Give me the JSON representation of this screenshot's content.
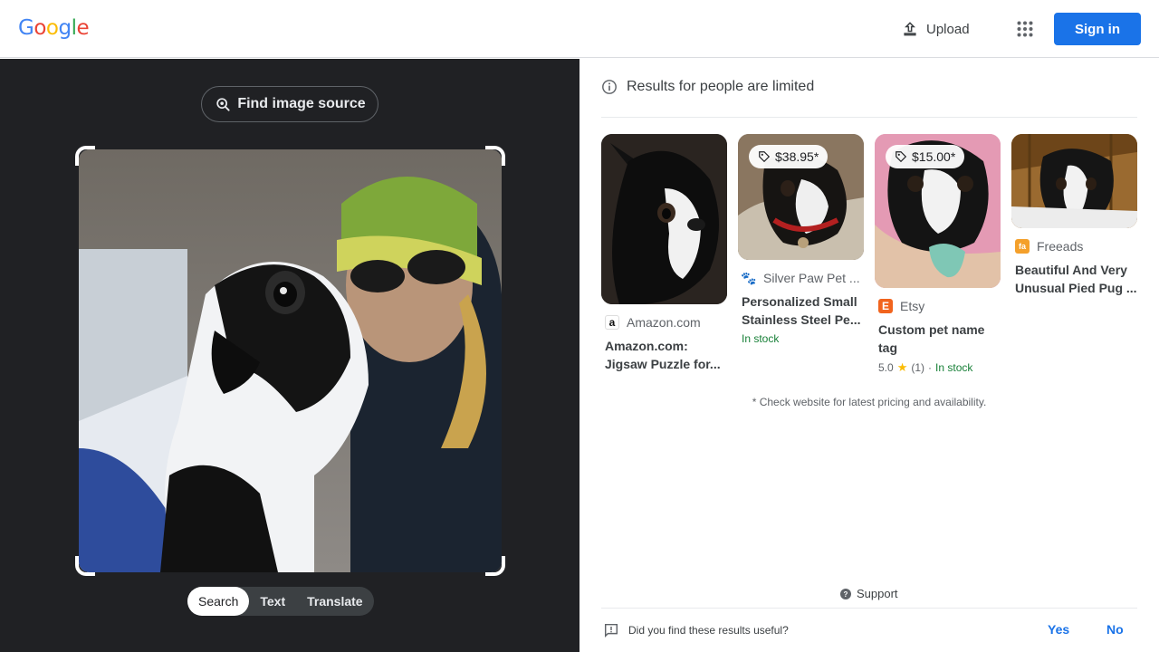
{
  "header": {
    "logo_letters": [
      {
        "char": "G",
        "color": "#4285f4"
      },
      {
        "char": "o",
        "color": "#ea4335"
      },
      {
        "char": "o",
        "color": "#fbbc05"
      },
      {
        "char": "g",
        "color": "#4285f4"
      },
      {
        "char": "l",
        "color": "#34a853"
      },
      {
        "char": "e",
        "color": "#ea4335"
      }
    ],
    "upload_label": "Upload",
    "upload_icon": "upload-icon",
    "apps_icon": "apps-grid-icon",
    "signin_label": "Sign in"
  },
  "lens": {
    "find_source_label": "Find image source",
    "find_source_icon": "image-search-icon",
    "tabs": [
      {
        "label": "Search",
        "active": true
      },
      {
        "label": "Text",
        "active": false
      },
      {
        "label": "Translate",
        "active": false
      }
    ]
  },
  "results": {
    "notice": "Results for people are limited",
    "notice_icon": "info-icon",
    "cards": [
      {
        "source": "Amazon.com",
        "source_icon": "amazon-icon",
        "title": "Amazon.com: Jigsaw Puzzle for...",
        "price": "",
        "stock": "",
        "rating": ""
      },
      {
        "source": "Silver Paw Pet ...",
        "source_icon": "paw-icon",
        "title": "Personalized Small Stainless Steel Pe...",
        "price": "$38.95*",
        "stock": "In stock",
        "rating": ""
      },
      {
        "source": "Etsy",
        "source_icon": "etsy-icon",
        "title": "Custom pet name tag",
        "price": "$15.00*",
        "stock": "",
        "rating": "5.0",
        "rating_count": "(1)",
        "rating_stock": "In stock"
      },
      {
        "source": "Freeads",
        "source_icon": "freeads-icon",
        "title": "Beautiful And Very Unusual Pied Pug ...",
        "price": "",
        "stock": "",
        "rating": ""
      }
    ],
    "pricing_note": "* Check website for latest pricing and availability.",
    "support_label": "Support",
    "feedback_question": "Did you find these results useful?",
    "feedback_yes": "Yes",
    "feedback_no": "No"
  }
}
